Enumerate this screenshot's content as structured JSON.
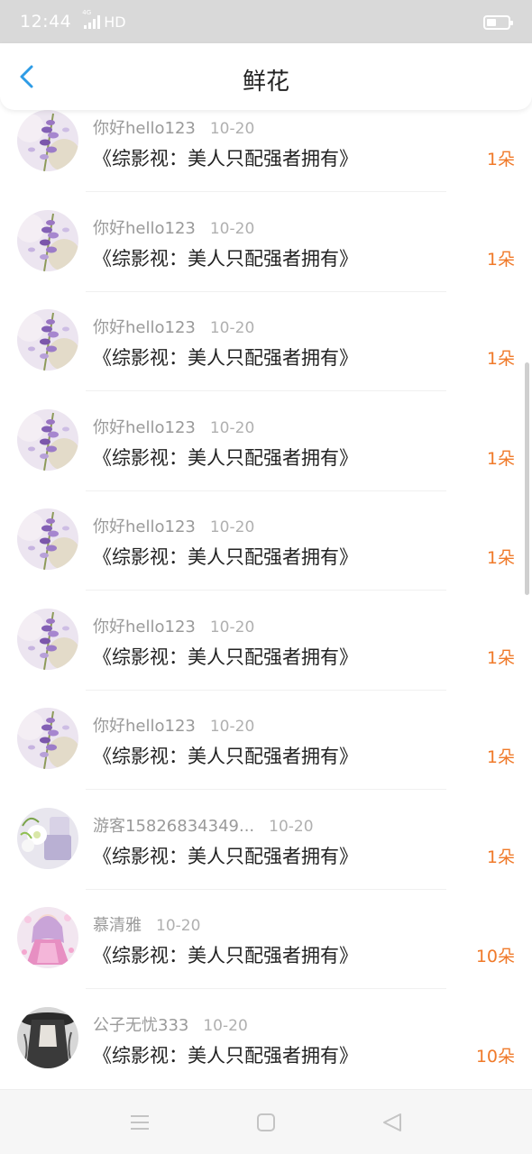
{
  "status_bar": {
    "time": "12:44",
    "network": "4G",
    "hd": "HD"
  },
  "header": {
    "title": "鲜花",
    "back_icon": "chevron-left-icon",
    "accent": "#2e9ce6"
  },
  "colors": {
    "count": "#f07a2a",
    "name": "#9a9a9a",
    "title": "#222222"
  },
  "items": [
    {
      "name": "你好hello123",
      "date": "10-20",
      "book": "《综影视：美人只配强者拥有》",
      "count": "1朵",
      "avatar": "lavender-flower-avatar"
    },
    {
      "name": "你好hello123",
      "date": "10-20",
      "book": "《综影视：美人只配强者拥有》",
      "count": "1朵",
      "avatar": "lavender-flower-avatar"
    },
    {
      "name": "你好hello123",
      "date": "10-20",
      "book": "《综影视：美人只配强者拥有》",
      "count": "1朵",
      "avatar": "lavender-flower-avatar"
    },
    {
      "name": "你好hello123",
      "date": "10-20",
      "book": "《综影视：美人只配强者拥有》",
      "count": "1朵",
      "avatar": "lavender-flower-avatar"
    },
    {
      "name": "你好hello123",
      "date": "10-20",
      "book": "《综影视：美人只配强者拥有》",
      "count": "1朵",
      "avatar": "lavender-flower-avatar"
    },
    {
      "name": "你好hello123",
      "date": "10-20",
      "book": "《综影视：美人只配强者拥有》",
      "count": "1朵",
      "avatar": "lavender-flower-avatar"
    },
    {
      "name": "你好hello123",
      "date": "10-20",
      "book": "《综影视：美人只配强者拥有》",
      "count": "1朵",
      "avatar": "lavender-flower-avatar"
    },
    {
      "name": "游客15826834349...",
      "date": "10-20",
      "book": "《综影视：美人只配强者拥有》",
      "count": "1朵",
      "avatar": "white-flower-avatar"
    },
    {
      "name": "慕清雅",
      "date": "10-20",
      "book": "《综影视：美人只配强者拥有》",
      "count": "10朵",
      "avatar": "anime-girl-avatar"
    },
    {
      "name": "公子无忧333",
      "date": "10-20",
      "book": "《综影视：美人只配强者拥有》",
      "count": "10朵",
      "avatar": "dark-figure-avatar"
    }
  ],
  "navbar": {
    "menu_icon": "menu-icon",
    "home_icon": "home-square-icon",
    "back_icon": "back-triangle-icon"
  }
}
